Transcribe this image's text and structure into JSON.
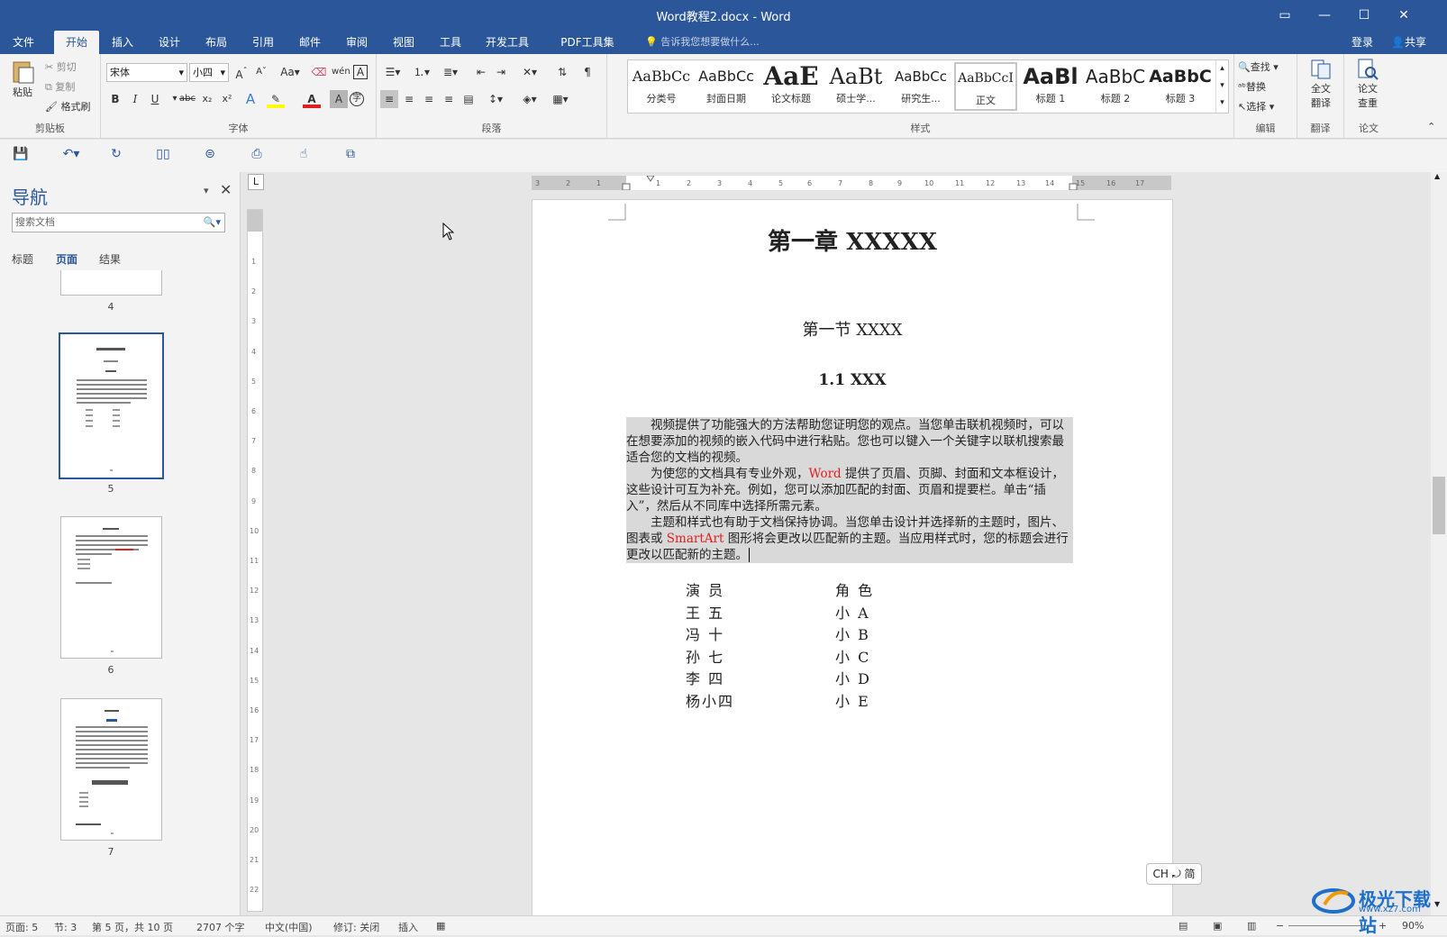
{
  "window": {
    "title": "Word教程2.docx - Word"
  },
  "tabs": [
    "文件",
    "开始",
    "插入",
    "设计",
    "布局",
    "引用",
    "邮件",
    "审阅",
    "视图",
    "工具",
    "开发工具",
    "PDF工具集"
  ],
  "active_tab": "开始",
  "tellme": "告诉我您想要做什么...",
  "account": {
    "login": "登录",
    "share": "共享"
  },
  "clipboard": {
    "paste": "粘贴",
    "cut": "剪切",
    "copy": "复制",
    "format_painter": "格式刷",
    "label": "剪贴板"
  },
  "font": {
    "name": "宋体",
    "size": "小四",
    "label": "字体"
  },
  "paragraph": {
    "label": "段落"
  },
  "styles": {
    "label": "样式",
    "items": [
      {
        "preview": "AaBbCc",
        "name": "分类号"
      },
      {
        "preview": "AaBbCc",
        "name": "封面日期"
      },
      {
        "preview": "AaE",
        "name": "论文标题"
      },
      {
        "preview": "AaBt",
        "name": "硕士学..."
      },
      {
        "preview": "AaBbCc",
        "name": "研究生..."
      },
      {
        "preview": "AaBbCcI",
        "name": "正文"
      },
      {
        "preview": "AaBl",
        "name": "标题 1"
      },
      {
        "preview": "AaBbC",
        "name": "标题 2"
      },
      {
        "preview": "AaBbC",
        "name": "标题 3"
      }
    ]
  },
  "editing": {
    "find": "查找",
    "replace": "替换",
    "select": "选择",
    "label": "编辑"
  },
  "translate": {
    "btn1": "全文",
    "btn2": "翻译",
    "label": "翻译"
  },
  "paper": {
    "btn1": "论文",
    "btn2": "查重",
    "label": "论文"
  },
  "nav": {
    "title": "导航",
    "search_placeholder": "搜索文档",
    "tabs": [
      "标题",
      "页面",
      "结果"
    ],
    "pages": [
      "4",
      "5",
      "6",
      "7"
    ]
  },
  "document": {
    "h1": "第一章  XXXXX",
    "h2": "第一节  XXXX",
    "h3": "1.1 XXX",
    "para1": "视频提供了功能强大的方法帮助您证明您的观点。当您单击联机视频时，可以在想要添加的视频的嵌入代码中进行粘贴。您也可以键入一个关键字以联机搜索最适合您的文档的视频。",
    "para2_a": "为使您的文档具有专业外观，",
    "para2_word": "Word",
    "para2_b": " 提供了页眉、页脚、封面和文本框设计，这些设计可互为补充。例如，您可以添加匹配的封面、页眉和提要栏。单击“插入”，然后从不同库中选择所需元素。",
    "para3_a": "主题和样式也有助于文档保持协调。当您单击设计并选择新的主题时，图片、图表或 ",
    "para3_smartart": "SmartArt",
    "para3_b": " 图形将会更改以匹配新的主题。当应用样式时，您的标题会进行更改以匹配新的主题。",
    "table": [
      [
        "演  员",
        "角  色"
      ],
      [
        "王  五",
        "小  A"
      ],
      [
        "冯  十",
        "小  B"
      ],
      [
        "孙  七",
        "小  C"
      ],
      [
        "李  四",
        "小  D"
      ],
      [
        "杨小四",
        "小  E"
      ]
    ]
  },
  "status": {
    "page": "页面: 5",
    "section": "节: 3",
    "pageof": "第 5 页，共 10 页",
    "words": "2707 个字",
    "lang": "中文(中国)",
    "track": "修订: 关闭",
    "mode": "插入",
    "zoom": "90%"
  },
  "ime": "CH ⤾ 简",
  "watermark": {
    "text": "极光下载站",
    "url": "www.xz7.com"
  },
  "colors": {
    "brand": "#2b579a",
    "red_text": "#e0201e"
  }
}
